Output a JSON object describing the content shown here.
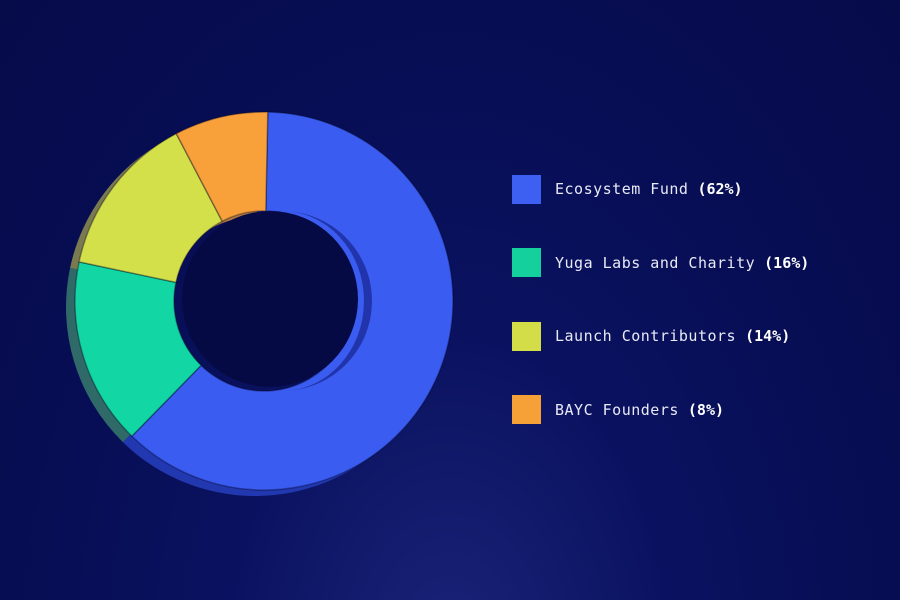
{
  "chart_data": {
    "type": "pie",
    "subtype": "donut",
    "title": "",
    "categories": [
      "Ecosystem Fund",
      "Yuga Labs and Charity",
      "Launch Contributors",
      "BAYC Founders"
    ],
    "values": [
      62,
      16,
      14,
      8
    ],
    "unit": "%",
    "colors": [
      "#3a5cf0",
      "#12d6a4",
      "#d4e04a",
      "#f8a03a"
    ],
    "legend_position": "right",
    "legend": [
      {
        "label": "Ecosystem Fund",
        "pct": "(62%)"
      },
      {
        "label": "Yuga Labs and Charity",
        "pct": "(16%)"
      },
      {
        "label": "Launch Contributors",
        "pct": "(14%)"
      },
      {
        "label": "BAYC Founders",
        "pct": "(8%)"
      }
    ]
  }
}
